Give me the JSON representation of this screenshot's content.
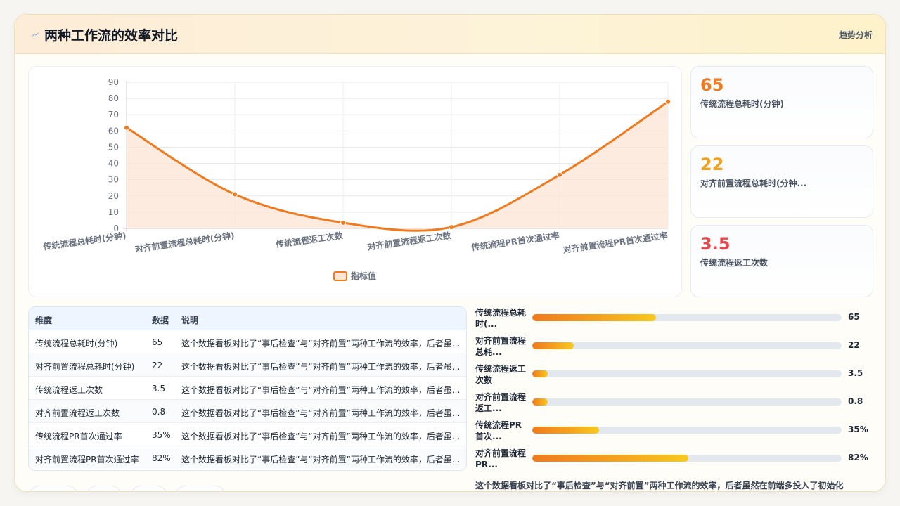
{
  "header": {
    "title": "两种工作流的效率对比",
    "link": "趋势分析",
    "icon": "lightning-icon"
  },
  "kpis": [
    {
      "value": "65",
      "label": "传统流程总耗时(分钟)",
      "color": "#f07a1d"
    },
    {
      "value": "22",
      "label": "对齐前置流程总耗时(分钟...",
      "color": "#f0a21d"
    },
    {
      "value": "3.5",
      "label": "传统流程返工次数",
      "color": "#e5484d"
    }
  ],
  "chart_data": {
    "type": "area",
    "categories": [
      "传统流程总耗时(分钟)",
      "对齐前置流程总耗时(分钟)",
      "传统流程返工次数",
      "对齐前置流程返工次数",
      "传统流程PR首次通过率",
      "对齐前置流程PR首次通过率"
    ],
    "series": [
      {
        "name": "指标值",
        "values": [
          62,
          21,
          3.5,
          0.8,
          33,
          78
        ]
      }
    ],
    "ylim": [
      0,
      90
    ],
    "yticks": [
      0,
      10,
      20,
      30,
      40,
      50,
      60,
      70,
      80,
      90
    ],
    "grid": true,
    "legend": "bottom",
    "line_color": "#f07a1d",
    "fill_color": "#fde4d4"
  },
  "table": {
    "headers": [
      "维度",
      "数据",
      "说明"
    ],
    "rows": [
      [
        "传统流程总耗时(分钟)",
        "65",
        "这个数据看板对比了“事后检查”与“对齐前置”两种工作流的效率，后者虽..."
      ],
      [
        "对齐前置流程总耗时(分钟)",
        "22",
        "这个数据看板对比了“事后检查”与“对齐前置”两种工作流的效率，后者虽..."
      ],
      [
        "传统流程返工次数",
        "3.5",
        "这个数据看板对比了“事后检查”与“对齐前置”两种工作流的效率，后者虽..."
      ],
      [
        "对齐前置流程返工次数",
        "0.8",
        "这个数据看板对比了“事后检查”与“对齐前置”两种工作流的效率，后者虽..."
      ],
      [
        "传统流程PR首次通过率",
        "35%",
        "这个数据看板对比了“事后检查”与“对齐前置”两种工作流的效率，后者虽..."
      ],
      [
        "对齐前置流程PR首次通过率",
        "82%",
        "这个数据看板对比了“事后检查”与“对齐前置”两种工作流的效率，后者虽..."
      ]
    ]
  },
  "bars": [
    {
      "label": "传统流程总耗时(...",
      "value": "65",
      "fraction": 0.4
    },
    {
      "label": "对齐前置流程总耗...",
      "value": "22",
      "fraction": 0.135
    },
    {
      "label": "传统流程返工次数",
      "value": "3.5",
      "fraction": 0.05
    },
    {
      "label": "对齐前置流程返工...",
      "value": "0.8",
      "fraction": 0.05
    },
    {
      "label": "传统流程PR首次...",
      "value": "35%",
      "fraction": 0.215
    },
    {
      "label": "对齐前置流程PR...",
      "value": "82%",
      "fraction": 0.505
    }
  ],
  "summary": "这个数据看板对比了“事后检查”与“对齐前置”两种工作流的效率，后者虽然在前端多投入了初始化"
}
